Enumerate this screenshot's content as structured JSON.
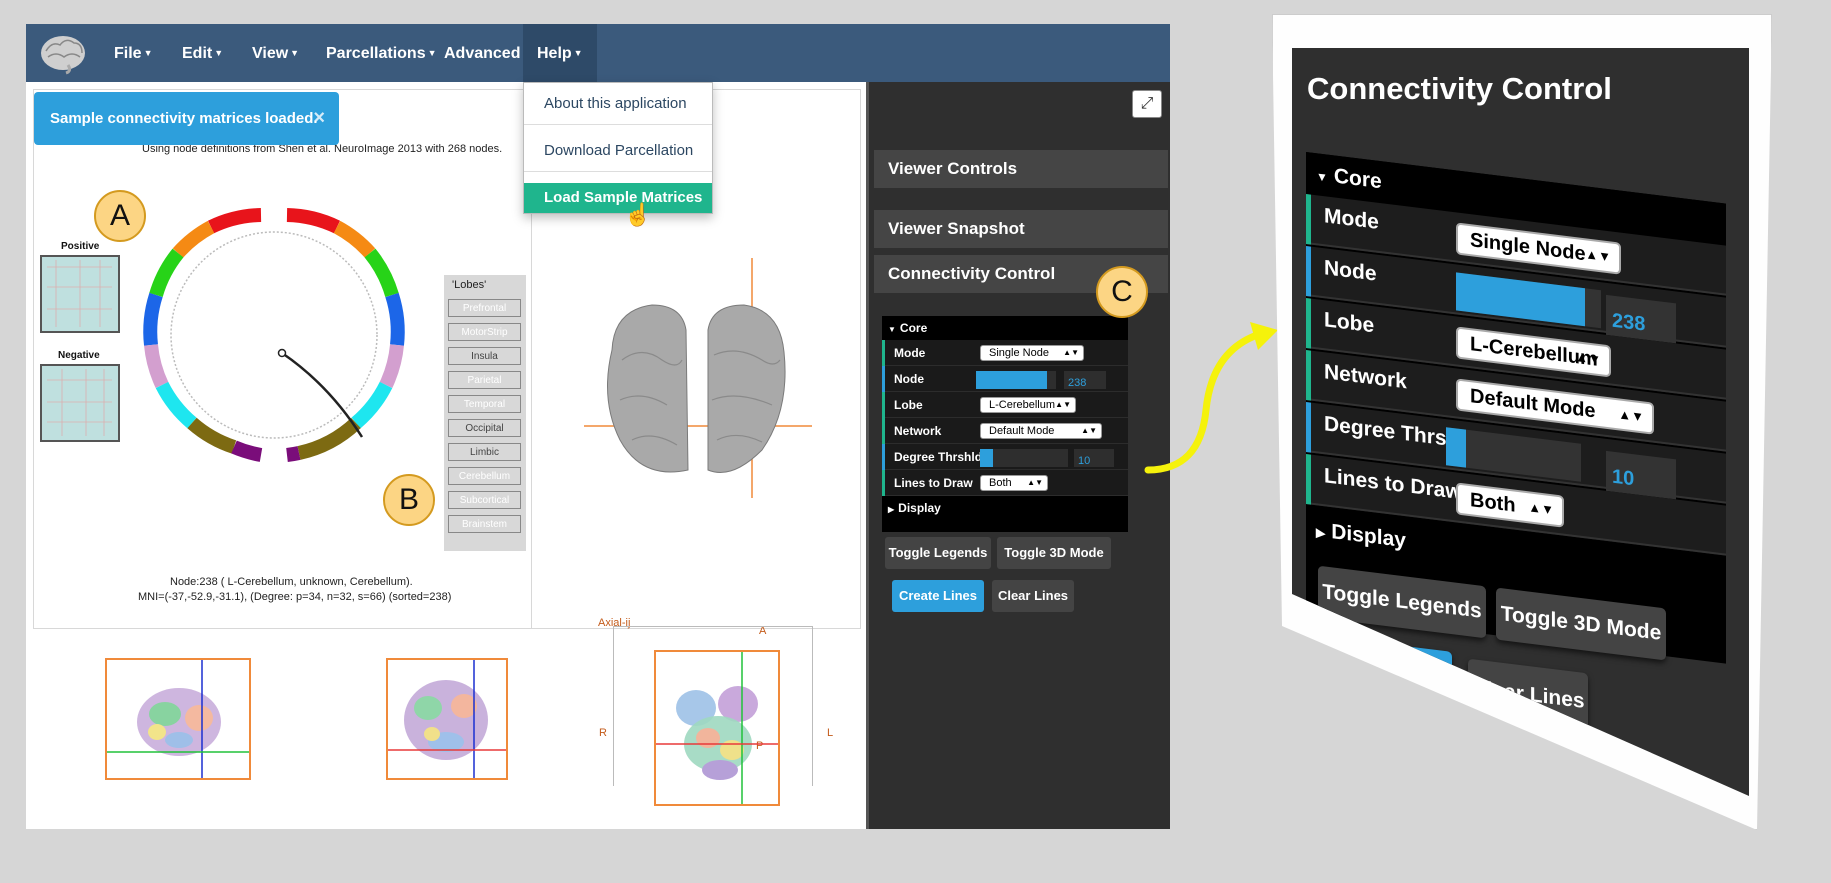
{
  "navbar": {
    "menus": [
      {
        "label": "File"
      },
      {
        "label": "Edit"
      },
      {
        "label": "View"
      },
      {
        "label": "Parcellations"
      },
      {
        "label": "Advanced"
      },
      {
        "label": "Help"
      }
    ],
    "help_menu": {
      "items": [
        {
          "label": "About this application"
        },
        {
          "label": "Download Parcellation"
        },
        {
          "label": "Load Sample Matrices"
        }
      ]
    }
  },
  "toast": {
    "message": "Sample connectivity matrices loaded.",
    "close": "×"
  },
  "connectogram": {
    "subtitle": "Using node definitions from Shen et al. NeuroImage 2013 with 268 nodes.",
    "positive_label": "Positive",
    "negative_label": "Negative",
    "node_info_line1": "Node:238 ( L-Cerebellum, unknown, Cerebellum).",
    "node_info_line2": "MNI=(-37,-52.9,-31.1), (Degree: p=34, n=32, s=66)  (sorted=238)",
    "legend_title": "'Lobes'",
    "lobes": [
      {
        "name": "Prefrontal",
        "color": "#e8141b"
      },
      {
        "name": "MotorStrip",
        "color": "#f58a14"
      },
      {
        "name": "Insula",
        "color": "#f4f019"
      },
      {
        "name": "Parietal",
        "color": "#27d318"
      },
      {
        "name": "Temporal",
        "color": "#1c66e8"
      },
      {
        "name": "Occipital",
        "color": "#d39fcf"
      },
      {
        "name": "Limbic",
        "color": "#1ee6ef"
      },
      {
        "name": "Cerebellum",
        "color": "#7d6a12"
      },
      {
        "name": "Subcortical",
        "color": "#f58a14"
      },
      {
        "name": "Brainstem",
        "color": "#7a0d7a"
      }
    ]
  },
  "annotations": {
    "a": "A",
    "b": "B",
    "c": "C"
  },
  "views2d": {
    "axial_title": "Axial-ij",
    "dir_a": "A",
    "dir_p": "P",
    "dir_r": "R",
    "dir_l": "L"
  },
  "sidebar": {
    "sections": [
      {
        "label": "Viewer Controls"
      },
      {
        "label": "Viewer Snapshot"
      },
      {
        "label": "Connectivity Control"
      }
    ],
    "expand_icon": "⤢",
    "gui": {
      "core_label": "Core",
      "display_label": "Display",
      "rows": [
        {
          "label": "Mode",
          "value": "Single Node",
          "bar_color": "#1fb58d"
        },
        {
          "label": "Node",
          "value": "238",
          "fraction": 0.89,
          "bar_color": "#2d9fdc"
        },
        {
          "label": "Lobe",
          "value": "L-Cerebellum",
          "bar_color": "#1fb58d"
        },
        {
          "label": "Network",
          "value": "Default Mode",
          "bar_color": "#1fb58d"
        },
        {
          "label": "Degree Thrshld",
          "value": "10",
          "fraction": 0.15,
          "bar_color": "#2d9fdc"
        },
        {
          "label": "Lines to Draw",
          "value": "Both",
          "bar_color": "#1fb58d"
        }
      ]
    },
    "buttons": {
      "toggle_legends": "Toggle Legends",
      "toggle_3d": "Toggle 3D Mode",
      "create_lines": "Create Lines",
      "clear_lines": "Clear Lines"
    }
  },
  "zoom": {
    "title": "Connectivity Control"
  },
  "colors": {
    "navbar": "#3b5a7c",
    "accent_blue": "#2d9fdc",
    "accent_green": "#1fb58d",
    "panel_dark": "#2f2f2f",
    "orange": "#f08a3a"
  }
}
